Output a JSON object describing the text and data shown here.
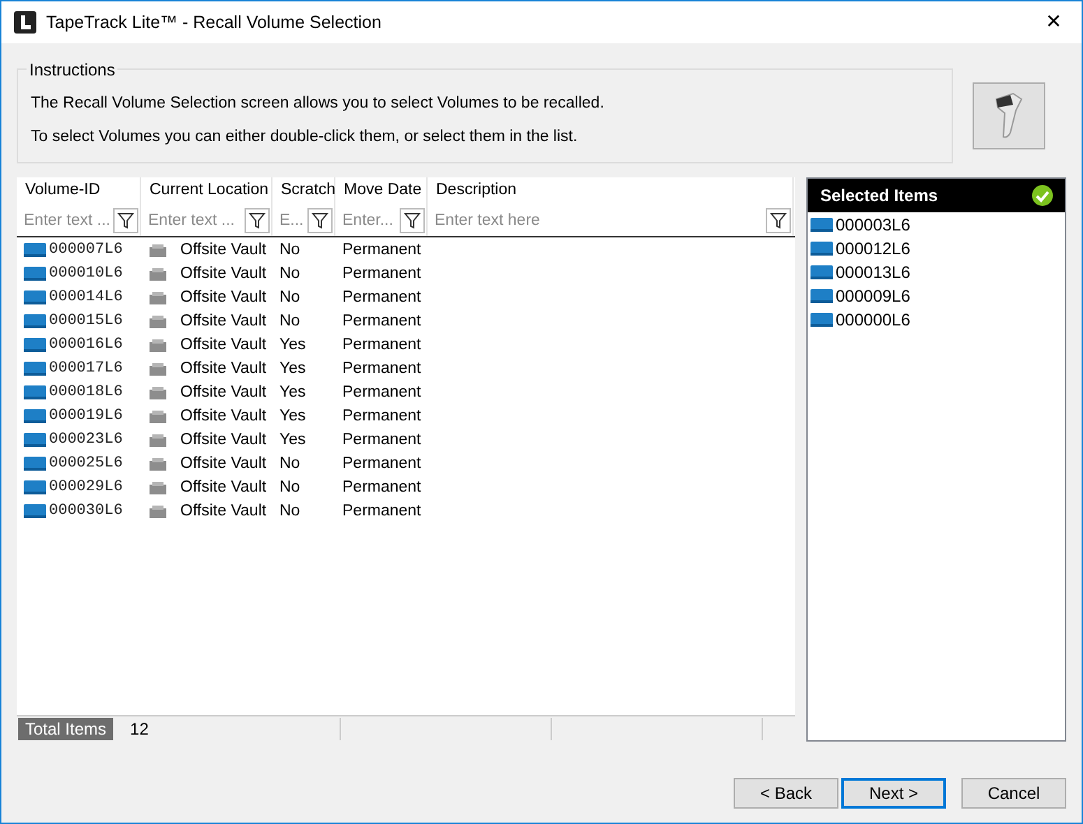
{
  "window": {
    "title": "TapeTrack Lite™ - Recall Volume Selection",
    "close": "✕"
  },
  "instructions": {
    "title": "Instructions",
    "lines": [
      "The Recall Volume Selection screen allows you to select Volumes to be recalled.",
      "To select Volumes you can either double-click them, or select them in the list."
    ]
  },
  "columns": [
    {
      "label": "Volume-ID",
      "placeholder": "Enter text ..."
    },
    {
      "label": "Current Location",
      "placeholder": "Enter text ..."
    },
    {
      "label": "Scratch",
      "placeholder": "E..."
    },
    {
      "label": "Move Date",
      "placeholder": "Enter..."
    },
    {
      "label": "Description",
      "placeholder": "Enter text here"
    }
  ],
  "rows": [
    {
      "volume_id": "000007L6",
      "location": "Offsite Vault",
      "scratch": "No",
      "move_date": "Permanent"
    },
    {
      "volume_id": "000010L6",
      "location": "Offsite Vault",
      "scratch": "No",
      "move_date": "Permanent"
    },
    {
      "volume_id": "000014L6",
      "location": "Offsite Vault",
      "scratch": "No",
      "move_date": "Permanent"
    },
    {
      "volume_id": "000015L6",
      "location": "Offsite Vault",
      "scratch": "No",
      "move_date": "Permanent"
    },
    {
      "volume_id": "000016L6",
      "location": "Offsite Vault",
      "scratch": "Yes",
      "move_date": "Permanent"
    },
    {
      "volume_id": "000017L6",
      "location": "Offsite Vault",
      "scratch": "Yes",
      "move_date": "Permanent"
    },
    {
      "volume_id": "000018L6",
      "location": "Offsite Vault",
      "scratch": "Yes",
      "move_date": "Permanent"
    },
    {
      "volume_id": "000019L6",
      "location": "Offsite Vault",
      "scratch": "Yes",
      "move_date": "Permanent"
    },
    {
      "volume_id": "000023L6",
      "location": "Offsite Vault",
      "scratch": "Yes",
      "move_date": "Permanent"
    },
    {
      "volume_id": "000025L6",
      "location": "Offsite Vault",
      "scratch": "No",
      "move_date": "Permanent"
    },
    {
      "volume_id": "000029L6",
      "location": "Offsite Vault",
      "scratch": "No",
      "move_date": "Permanent"
    },
    {
      "volume_id": "000030L6",
      "location": "Offsite Vault",
      "scratch": "No",
      "move_date": "Permanent"
    }
  ],
  "status_bar": {
    "label": "Total Items",
    "value": "12"
  },
  "selected_panel": {
    "title": "Selected Items",
    "items": [
      "000003L6",
      "000012L6",
      "000013L6",
      "000009L6",
      "000000L6"
    ]
  },
  "buttons": [
    {
      "label": "< Back",
      "default": false
    },
    {
      "label": "Next >",
      "default": true
    },
    {
      "label": "Cancel",
      "default": false
    }
  ]
}
